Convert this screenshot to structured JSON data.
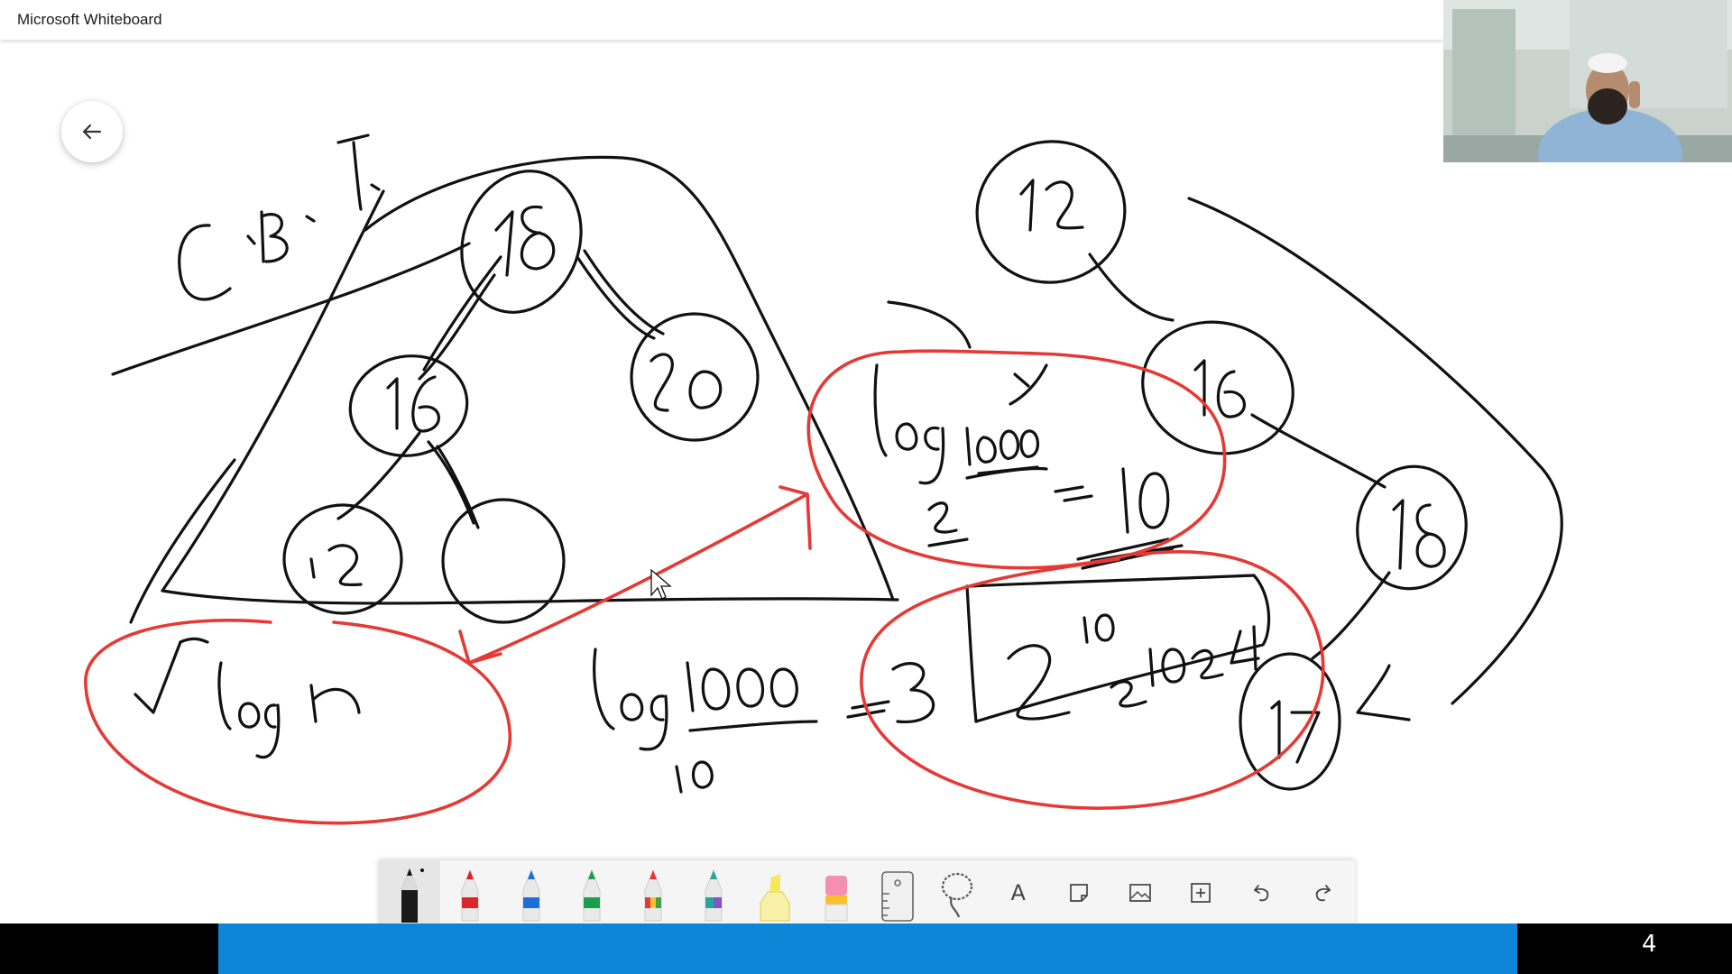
{
  "app": {
    "title": "Microsoft Whiteboard",
    "accent": "#0d86d8",
    "ink_colors": {
      "black": "#111111",
      "red": "#e53935"
    }
  },
  "canvas": {
    "back_button_icon": "arrow-left-icon",
    "handwriting": {
      "top_left_note": "C.B.T.",
      "left_tree_nodes": [
        "18",
        "16",
        "20",
        "12",
        ""
      ],
      "right_tree_nodes": [
        "12",
        "16",
        "18",
        "17"
      ],
      "log2_expression": "log2 1000 = 10",
      "log10_expression": "log10 1000 = 3",
      "power_expression": "2^10 = 1024",
      "circled_note": "√log n"
    }
  },
  "webcam": {
    "content": "presenter video thumbnail"
  },
  "toolbar": {
    "tools": [
      {
        "name": "ballpoint-pen-black",
        "icon": "pen-black-icon",
        "selected": true
      },
      {
        "name": "pen-red",
        "icon": "pen-red-icon"
      },
      {
        "name": "pen-blue",
        "icon": "pen-blue-icon"
      },
      {
        "name": "pen-green",
        "icon": "pen-green-icon"
      },
      {
        "name": "pen-rainbow",
        "icon": "pen-rainbow-icon"
      },
      {
        "name": "pen-galaxy",
        "icon": "pen-galaxy-icon"
      },
      {
        "name": "highlighter",
        "icon": "highlighter-icon"
      },
      {
        "name": "eraser",
        "icon": "eraser-icon"
      },
      {
        "name": "ruler",
        "icon": "ruler-icon"
      },
      {
        "name": "lasso-select",
        "icon": "lasso-icon"
      },
      {
        "name": "text",
        "icon": "text-icon",
        "glyph": "A"
      },
      {
        "name": "note",
        "icon": "note-icon"
      },
      {
        "name": "image",
        "icon": "image-icon"
      },
      {
        "name": "insert",
        "icon": "insert-icon"
      },
      {
        "name": "undo",
        "icon": "undo-icon"
      },
      {
        "name": "redo",
        "icon": "redo-icon"
      }
    ]
  },
  "bottom_bar": {
    "page_number": "4"
  }
}
